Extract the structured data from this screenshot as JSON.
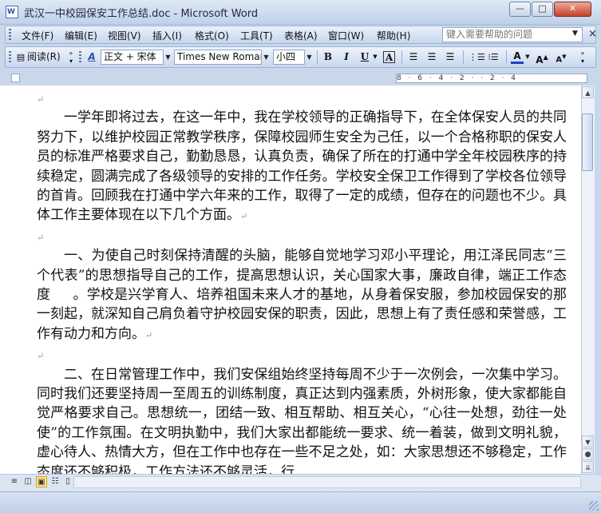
{
  "window": {
    "title": "武汉一中校园保安工作总结.doc - Microsoft Word",
    "app_icon_letter": "W",
    "minimize_glyph": "—",
    "maximize_glyph": "□",
    "close_glyph": "✕"
  },
  "menu": {
    "items": [
      "文件(F)",
      "编辑(E)",
      "视图(V)",
      "插入(I)",
      "格式(O)",
      "工具(T)",
      "表格(A)",
      "窗口(W)",
      "帮助(H)"
    ],
    "help_placeholder": "键入需要帮助的问题",
    "close_doc_glyph": "×"
  },
  "toolbar": {
    "read_label": "阅读(R)",
    "style_icon": "A",
    "style_value": "正文 + 宋体",
    "font_value": "Times New Roman",
    "size_value": "小四",
    "bold": "B",
    "italic": "I",
    "underline": "U",
    "char_border": "A",
    "font_color": "A",
    "grow_font": "A",
    "shrink_font": "A"
  },
  "ruler": {
    "text": "8 · 6 · 4 · 2 · · 2 · 4"
  },
  "document": {
    "paragraph_mark": "↵",
    "paragraphs": [
      "一学年即将过去，在这一年中，我在学校领导的正确指导下，在全体保安人员的共同努力下，以维护校园正常教学秩序，保障校园师生安全为己任，以一个合格称职的保安人员的标准严格要求自己，勤勤恳恳，认真负责，确保了所在的打通中学全年校园秩序的持续稳定，圆满完成了各级领导的安排的工作任务。学校安全保卫工作得到了学校各位领导的首肯。回顾我在打通中学六年来的工作，取得了一定的成绩，但存在的问题也不少。具体工作主要体现在以下几个方面。",
      "一、为使自己时刻保持清醒的头脑，能够自觉地学习邓小平理论，用江泽民同志“三个代表”的思想指导自己的工作，提高思想认识，关心国家大事，廉政自律，端正工作态度 　 。学校是兴学育人、培养祖国未来人才的基地，从身着保安服，参加校园保安的那一刻起，就深知自己肩负着守护校园安保的职责，因此，思想上有了责任感和荣誉感，工作有动力和方向。",
      "二、在日常管理工作中，我们安保组始终坚持每周不少于一次例会，一次集中学习。同时我们还要坚持周一至周五的训练制度，真正达到内强素质，外树形象，使大家都能自觉严格要求自己。思想统一，团结一致、相互帮助、相互关心，“心往一处想，劲往一处使”的工作氛围。在文明执勤中，我们大家出都能统一要求、统一着装，做到文明礼貌，虚心待人、热情大方，但在工作中也存在一些不足之处，如：大家思想还不够稳定，工作态度还不够积极，工作方法还不够灵活，行"
    ]
  },
  "statusbar": {}
}
